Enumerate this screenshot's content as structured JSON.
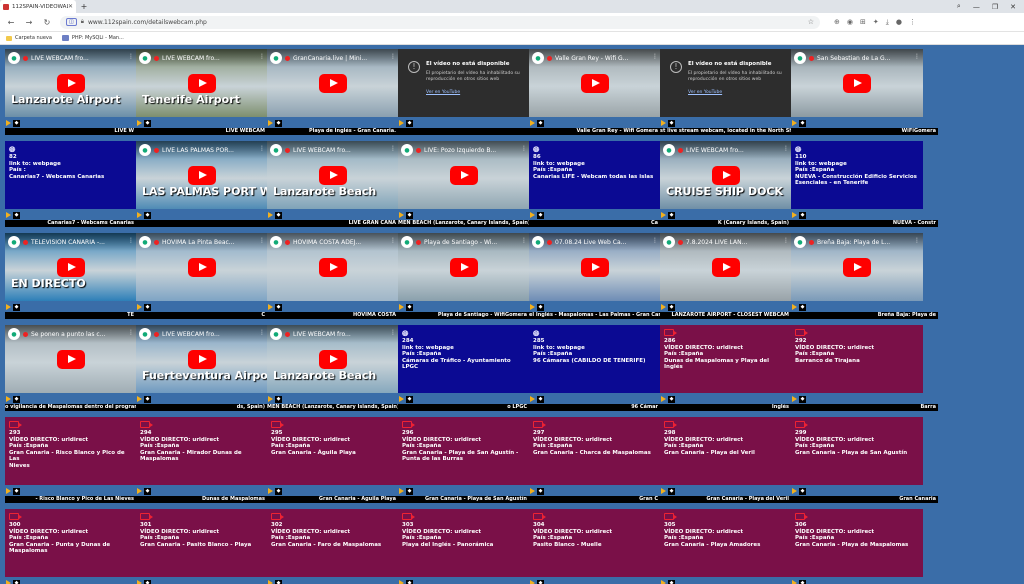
{
  "browser": {
    "tab_title": "112SPAIN-VIDEOWALL",
    "url": "www.112spain.com/detailswebcam.php",
    "bookmarks": [
      "Carpeta nueva",
      "PHP: MySQLi - Man..."
    ]
  },
  "colors": {
    "page_bg": "#3a6da8",
    "info_blue": "#0b0a93",
    "info_maroon": "#7a1048",
    "yt_red": "#ff0000",
    "play_ctrl": "#f2b01e"
  },
  "unavailable": {
    "title": "El vídeo no está disponible",
    "body": "El propietario del vídeo ha inhabilitado su reproducción en otros sitios web",
    "link": "Ver en YouTube"
  },
  "rows": [
    {
      "cells": [
        {
          "kind": "video",
          "title": "LIVE WEBCAM fro...",
          "overlay": "Lanzarote Airport",
          "bg": "#6b8fa8",
          "caption": "LIVE W"
        },
        {
          "kind": "video",
          "title": "LIVE WEBCAM fro...",
          "overlay": "Tenerife Airport",
          "bg": "#7d8f6e",
          "caption": "LIVE WEBCAM"
        },
        {
          "kind": "video",
          "title": "GranCanaria.live | Mini...",
          "overlay": "",
          "bg": "#8aa0b0",
          "caption": "Playa de Inglés - Gran Canaria."
        },
        {
          "kind": "unavailable",
          "caption": ""
        },
        {
          "kind": "video",
          "title": "Valle Gran Rey - Wifi G...",
          "overlay": "",
          "bg": "#9aa4a8",
          "caption": "Valle Gran Rey - Wifi Gomera"
        },
        {
          "kind": "unavailable",
          "caption": "st live stream webcam, located in the North Shore of"
        },
        {
          "kind": "video",
          "title": "San Sebastian de La G...",
          "overlay": "",
          "bg": "#8c9aa2",
          "caption": "WiFiGomera"
        }
      ]
    },
    {
      "cells": [
        {
          "kind": "info",
          "color": "blue",
          "icon": "globe",
          "lines": [
            "82",
            "link to: webpage",
            "País :",
            "Canarias7 - Webcams Canarias"
          ],
          "caption": "Canarias7 - Webcams Canarias"
        },
        {
          "kind": "video",
          "title": "LIVE LAS PALMAS POR...",
          "overlay": "LAS PALMAS PORT WEBCAM",
          "bg": "#4f8bb5",
          "caption": ""
        },
        {
          "kind": "video",
          "title": "LIVE WEBCAM fro...",
          "overlay": "Lanzarote Beach",
          "bg": "#7fa3b8",
          "caption": "LIVE GRAN CANA"
        },
        {
          "kind": "video",
          "title": "LIVE: Pozo Izquierdo B...",
          "overlay": "",
          "bg": "#8fa6b2",
          "caption": "MEN BEACH (Lanzarote, Canary Islands, Spain)"
        },
        {
          "kind": "info",
          "color": "blue",
          "icon": "globe",
          "lines": [
            "86",
            "link to: webpage",
            "País :España",
            "Canarias LIFE - Webcam todas las islas"
          ],
          "caption": "Ca"
        },
        {
          "kind": "video",
          "title": "LIVE WEBCAM fro...",
          "overlay": "CRUISE SHIP DOCK",
          "bg": "#6f8fa6",
          "caption": "K (Canary Islands, Spain)"
        },
        {
          "kind": "info",
          "color": "blue",
          "icon": "globe",
          "lines": [
            "110",
            "link to: webpage",
            "País :España",
            "NUEVA - Construcción Edificio Servicios",
            "Esenciales - en Tenerife"
          ],
          "caption": "NUEVA - Constr"
        }
      ]
    },
    {
      "cells": [
        {
          "kind": "video",
          "title": "TELEVISION CANARIA -...",
          "overlay": "EN DIRECTO",
          "bg": "#2d7fb8",
          "caption": "TE"
        },
        {
          "kind": "video",
          "title": "HOVIMA La Pinta Beac...",
          "overlay": "",
          "bg": "#7ea4c4",
          "caption": "C"
        },
        {
          "kind": "video",
          "title": "HOVIMA COSTA ADEJ...",
          "overlay": "",
          "bg": "#9fb6c8",
          "caption": "HOVIMA COSTA"
        },
        {
          "kind": "video",
          "title": "Playa de Santiago - Wi...",
          "overlay": "",
          "bg": "#8aa0ac",
          "caption": "Playa de Santiago - WifiGomera"
        },
        {
          "kind": "video",
          "title": "07.08.24 Live Web Ca...",
          "overlay": "",
          "bg": "#6d8cb5",
          "caption": "el Inglés - Maspalomas - Las Palmas - Gran Canaria"
        },
        {
          "kind": "video",
          "title": "7.8.2024 LIVE LAN...",
          "overlay": "",
          "bg": "#98a2a8",
          "caption": "LANZAROTE AIRPORT - CLOSEST WEBCAM"
        },
        {
          "kind": "video",
          "title": "Breña Baja: Playa de L...",
          "overlay": "",
          "bg": "#7a9ab8",
          "caption": "Breña Baja: Playa de"
        }
      ]
    },
    {
      "cells": [
        {
          "kind": "video",
          "title": "Se ponen a punto las c...",
          "overlay": "",
          "bg": "#a0adb4",
          "caption": "o vigilancia de Maspalomas dentro del programa del"
        },
        {
          "kind": "video",
          "title": "LIVE WEBCAM fro...",
          "overlay": "Fuerteventura Airport",
          "bg": "#6f9ac0",
          "caption": "ds, Spain)"
        },
        {
          "kind": "video",
          "title": "LIVE WEBCAM fro...",
          "overlay": "Lanzarote Beach",
          "bg": "#86a8bd",
          "caption": "MEN BEACH (Lanzarote, Canary Islands, Spain)"
        },
        {
          "kind": "info",
          "color": "blue",
          "icon": "globe",
          "lines": [
            "284",
            "link to: webpage",
            "País :España",
            "Cámaras de Tráfico - Ayuntamiento LPGC"
          ],
          "caption": "o LPGC"
        },
        {
          "kind": "info",
          "color": "blue",
          "icon": "globe",
          "lines": [
            "285",
            "link to: webpage",
            "País :España",
            "96 Cámaras (CABILDO DE TENERIFE)"
          ],
          "caption": "96 Cámar"
        },
        {
          "kind": "info",
          "color": "maroon",
          "icon": "cam",
          "lines": [
            "286",
            "VÍDEO DIRECTO: urldirect",
            "País :España",
            "Dunas de Maspalomas y Playa del Inglés"
          ],
          "caption": "Inglés"
        },
        {
          "kind": "info",
          "color": "maroon",
          "icon": "cam",
          "lines": [
            "292",
            "VÍDEO DIRECTO: urldirect",
            "País :España",
            "Barranco de Tirajana"
          ],
          "caption": "Barra"
        }
      ]
    },
    {
      "cells": [
        {
          "kind": "info",
          "color": "maroon",
          "icon": "cam",
          "lines": [
            "293",
            "VÍDEO DIRECTO: urldirect",
            "País :España",
            "Gran Canaria - Risco Blanco y Pico de Las",
            "Nieves"
          ],
          "caption": "- Risco Blanco y Pico de Las Nieves"
        },
        {
          "kind": "info",
          "color": "maroon",
          "icon": "cam",
          "lines": [
            "294",
            "VÍDEO DIRECTO: urldirect",
            "País :España",
            "Gran Canaria - Mirador Dunas de",
            "Maspalomas"
          ],
          "caption": "Dunas de Maspalomas"
        },
        {
          "kind": "info",
          "color": "maroon",
          "icon": "cam",
          "lines": [
            "295",
            "VÍDEO DIRECTO: urldirect",
            "País :España",
            "Gran Canaria - Águila Playa"
          ],
          "caption": "Gran Canaria - Águila Playa"
        },
        {
          "kind": "info",
          "color": "maroon",
          "icon": "cam",
          "lines": [
            "296",
            "VÍDEO DIRECTO: urldirect",
            "País :España",
            "Gran Canaria - Playa de San Agustín -",
            "Punta de las Burras"
          ],
          "caption": "Gran Canaria - Playa de San Agustín"
        },
        {
          "kind": "info",
          "color": "maroon",
          "icon": "cam",
          "lines": [
            "297",
            "VÍDEO DIRECTO: urldirect",
            "País :España",
            "Gran Canaria - Charca de Maspalomas"
          ],
          "caption": "Gran C"
        },
        {
          "kind": "info",
          "color": "maroon",
          "icon": "cam",
          "lines": [
            "298",
            "VÍDEO DIRECTO: urldirect",
            "País :España",
            "Gran Canaria - Playa del Veril"
          ],
          "caption": "Gran Canaria - Playa del Veril"
        },
        {
          "kind": "info",
          "color": "maroon",
          "icon": "cam",
          "lines": [
            "299",
            "VÍDEO DIRECTO: urldirect",
            "País :España",
            "Gran Canaria - Playa de San Agustín"
          ],
          "caption": "Gran Canaria"
        }
      ]
    },
    {
      "cells": [
        {
          "kind": "info",
          "color": "maroon",
          "icon": "cam",
          "lines": [
            "300",
            "VÍDEO DIRECTO: urldirect",
            "País :España",
            "Gran Canaria - Punta y Dunas de",
            "Maspalomas"
          ],
          "caption": ""
        },
        {
          "kind": "info",
          "color": "maroon",
          "icon": "cam",
          "lines": [
            "301",
            "VÍDEO DIRECTO: urldirect",
            "País :España",
            "Gran Canaria - Pasito Blanco - Playa"
          ],
          "caption": ""
        },
        {
          "kind": "info",
          "color": "maroon",
          "icon": "cam",
          "lines": [
            "302",
            "VÍDEO DIRECTO: urldirect",
            "País :España",
            "Gran Canaria - Faro de Maspalomas"
          ],
          "caption": ""
        },
        {
          "kind": "info",
          "color": "maroon",
          "icon": "cam",
          "lines": [
            "303",
            "VÍDEO DIRECTO: urldirect",
            "País :España",
            "Playa del Inglés - Panorámica"
          ],
          "caption": ""
        },
        {
          "kind": "info",
          "color": "maroon",
          "icon": "cam",
          "lines": [
            "304",
            "VÍDEO DIRECTO: urldirect",
            "País :España",
            "Pasito Blanco - Muelle"
          ],
          "caption": ""
        },
        {
          "kind": "info",
          "color": "maroon",
          "icon": "cam",
          "lines": [
            "305",
            "VÍDEO DIRECTO: urldirect",
            "País :España",
            "Gran Canaria - Playa Amadores"
          ],
          "caption": ""
        },
        {
          "kind": "info",
          "color": "maroon",
          "icon": "cam",
          "lines": [
            "306",
            "VÍDEO DIRECTO: urldirect",
            "País :España",
            "Gran Canaria - Playa de Maspalomas"
          ],
          "caption": ""
        }
      ]
    }
  ]
}
